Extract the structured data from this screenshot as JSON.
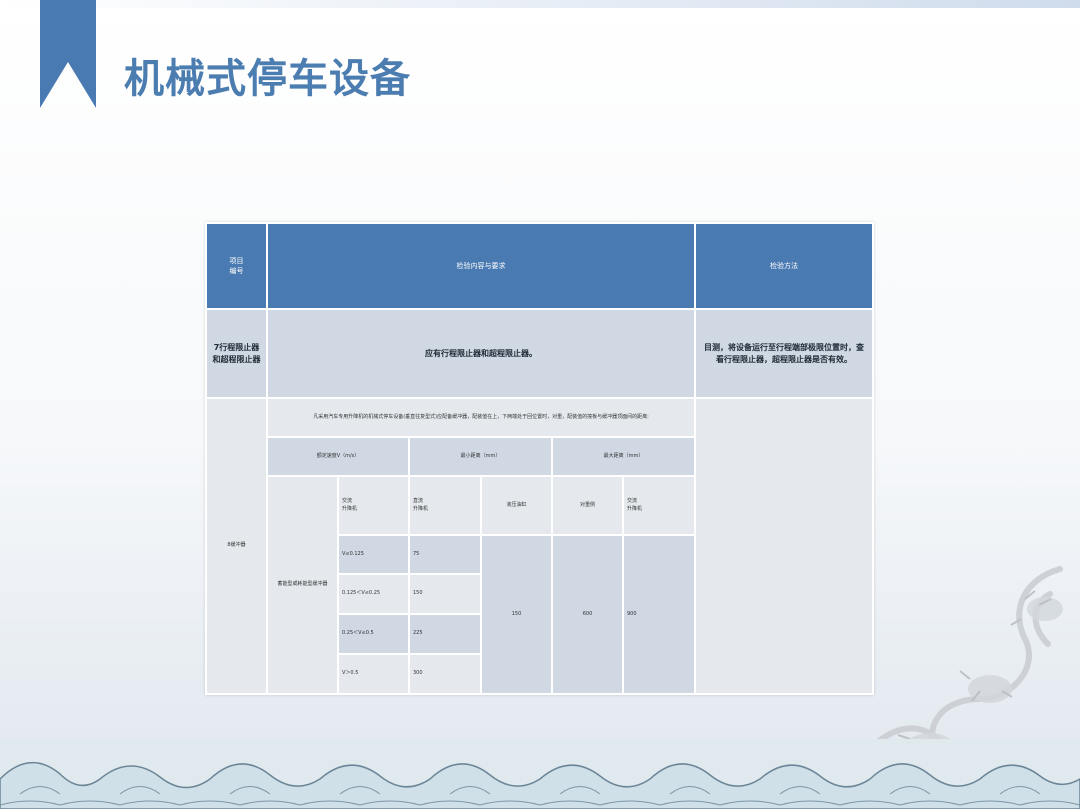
{
  "page": {
    "title": "机械式停车设备"
  },
  "table": {
    "header": {
      "item_no": "项目\n编号",
      "content": "检验内容与要求",
      "method": "检验方法"
    },
    "row7": {
      "item": "7行程限止器\n和超程限止器",
      "content": "应有行程限止器和超程限止器。",
      "method": "目测，将设备运行至行程端部极限位置时，查看行程限止器，超程限止器是否有效。"
    },
    "row8": {
      "item": "8缓冲器",
      "note": "凡采用汽车专用升降机的机械式停车设备(垂直往复型式)应配备缓冲器，配装值在上，下两端处于回位置时，对重，配装值的撞板与缓冲器顶面间的距离:",
      "col_speed": "额定速度V（m/s）",
      "col_min": "最小距离（mm）",
      "col_max": "最大距离（mm）",
      "type_label": "蓄能型或耗能型缓冲器",
      "sub_ac": "交流\n升降机",
      "sub_dc": "直流\n升降机",
      "sub_hydraulic": "液压油缸",
      "sub_counter": "对重侧",
      "sub_ac2": "交流\n升降机",
      "speeds": [
        "V≤0.125",
        "0.125＜V≤0.25",
        "0.25＜V≤0.5",
        "V＞0.5"
      ],
      "min_values": [
        "75",
        "150",
        "225",
        "300"
      ],
      "hydraulic_value": "150",
      "counter_value": "600",
      "ac2_value": "900"
    }
  }
}
